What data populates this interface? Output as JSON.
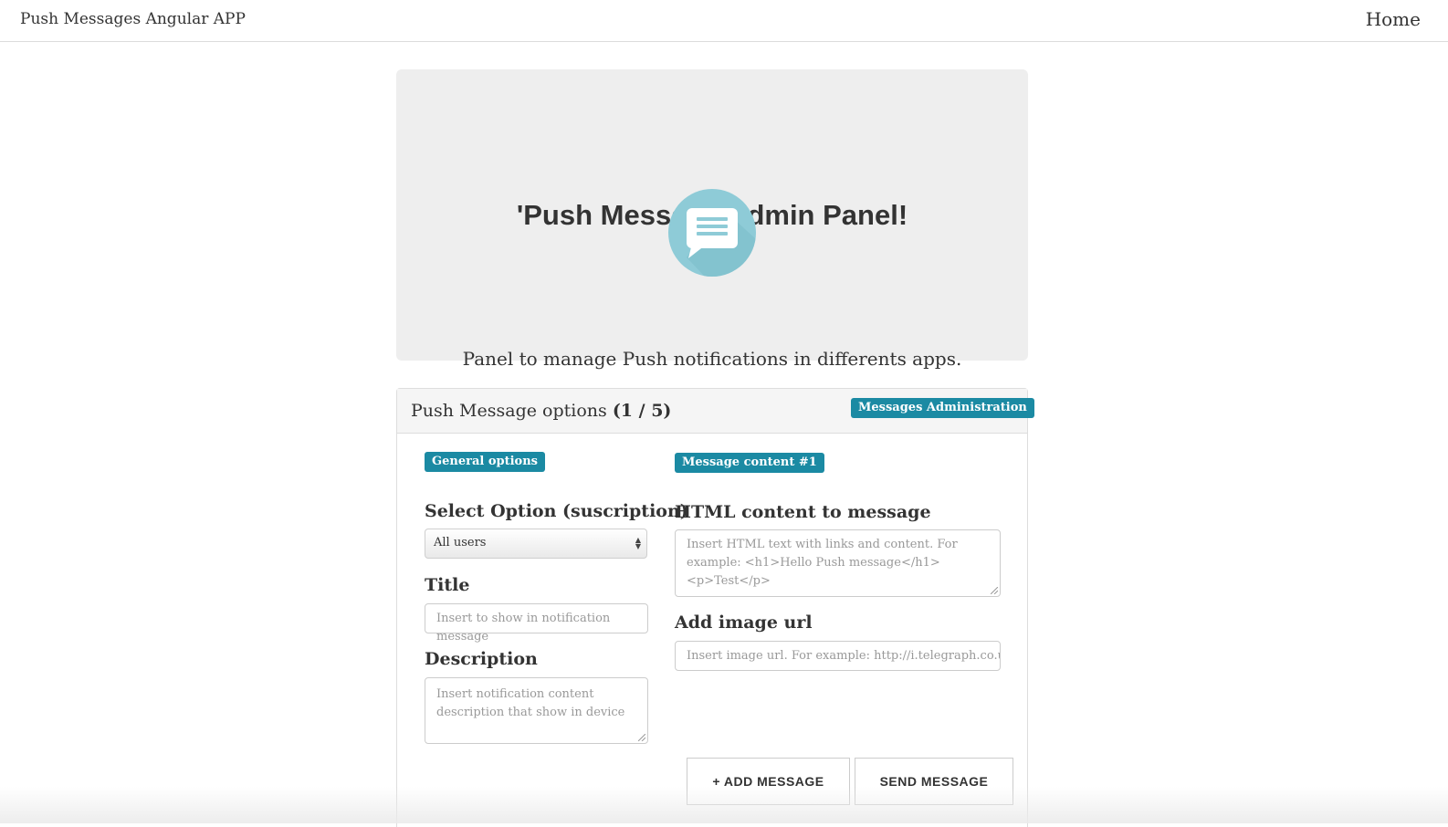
{
  "navbar": {
    "brand": "Push Messages Angular APP",
    "home": "Home"
  },
  "jumbotron": {
    "title": "'Push Message Admin Panel!",
    "icon": "chat-bubble-icon",
    "subtitle": "Panel to manage Push notifications in differents apps."
  },
  "panel": {
    "title_text": "Push Message options ",
    "title_counter": "(1 / 5)",
    "admin_badge": "Messages Administration",
    "general_badge": "General options",
    "content_badge": "Message content #1",
    "select_label": "Select Option (suscription)",
    "select_value": "All users",
    "title_label": "Title",
    "title_placeholder": "Insert to show in notification message",
    "description_label": "Description",
    "description_placeholder": "Insert notification content description that show in device",
    "html_label": "HTML content to message",
    "html_placeholder": "Insert HTML text with links and content. For example: <h1>Hello Push message</h1> <p>Test</p>",
    "image_label": "Add image url",
    "image_placeholder": "Insert image url. For example: http://i.telegraph.co.uk/multi",
    "add_button": "+ ADD MESSAGE",
    "send_button": "SEND MESSAGE"
  },
  "colors": {
    "badge": "#1b8aa3",
    "icon_circle": "#8ecbd7",
    "jumbotron_bg": "#eeeeee"
  }
}
